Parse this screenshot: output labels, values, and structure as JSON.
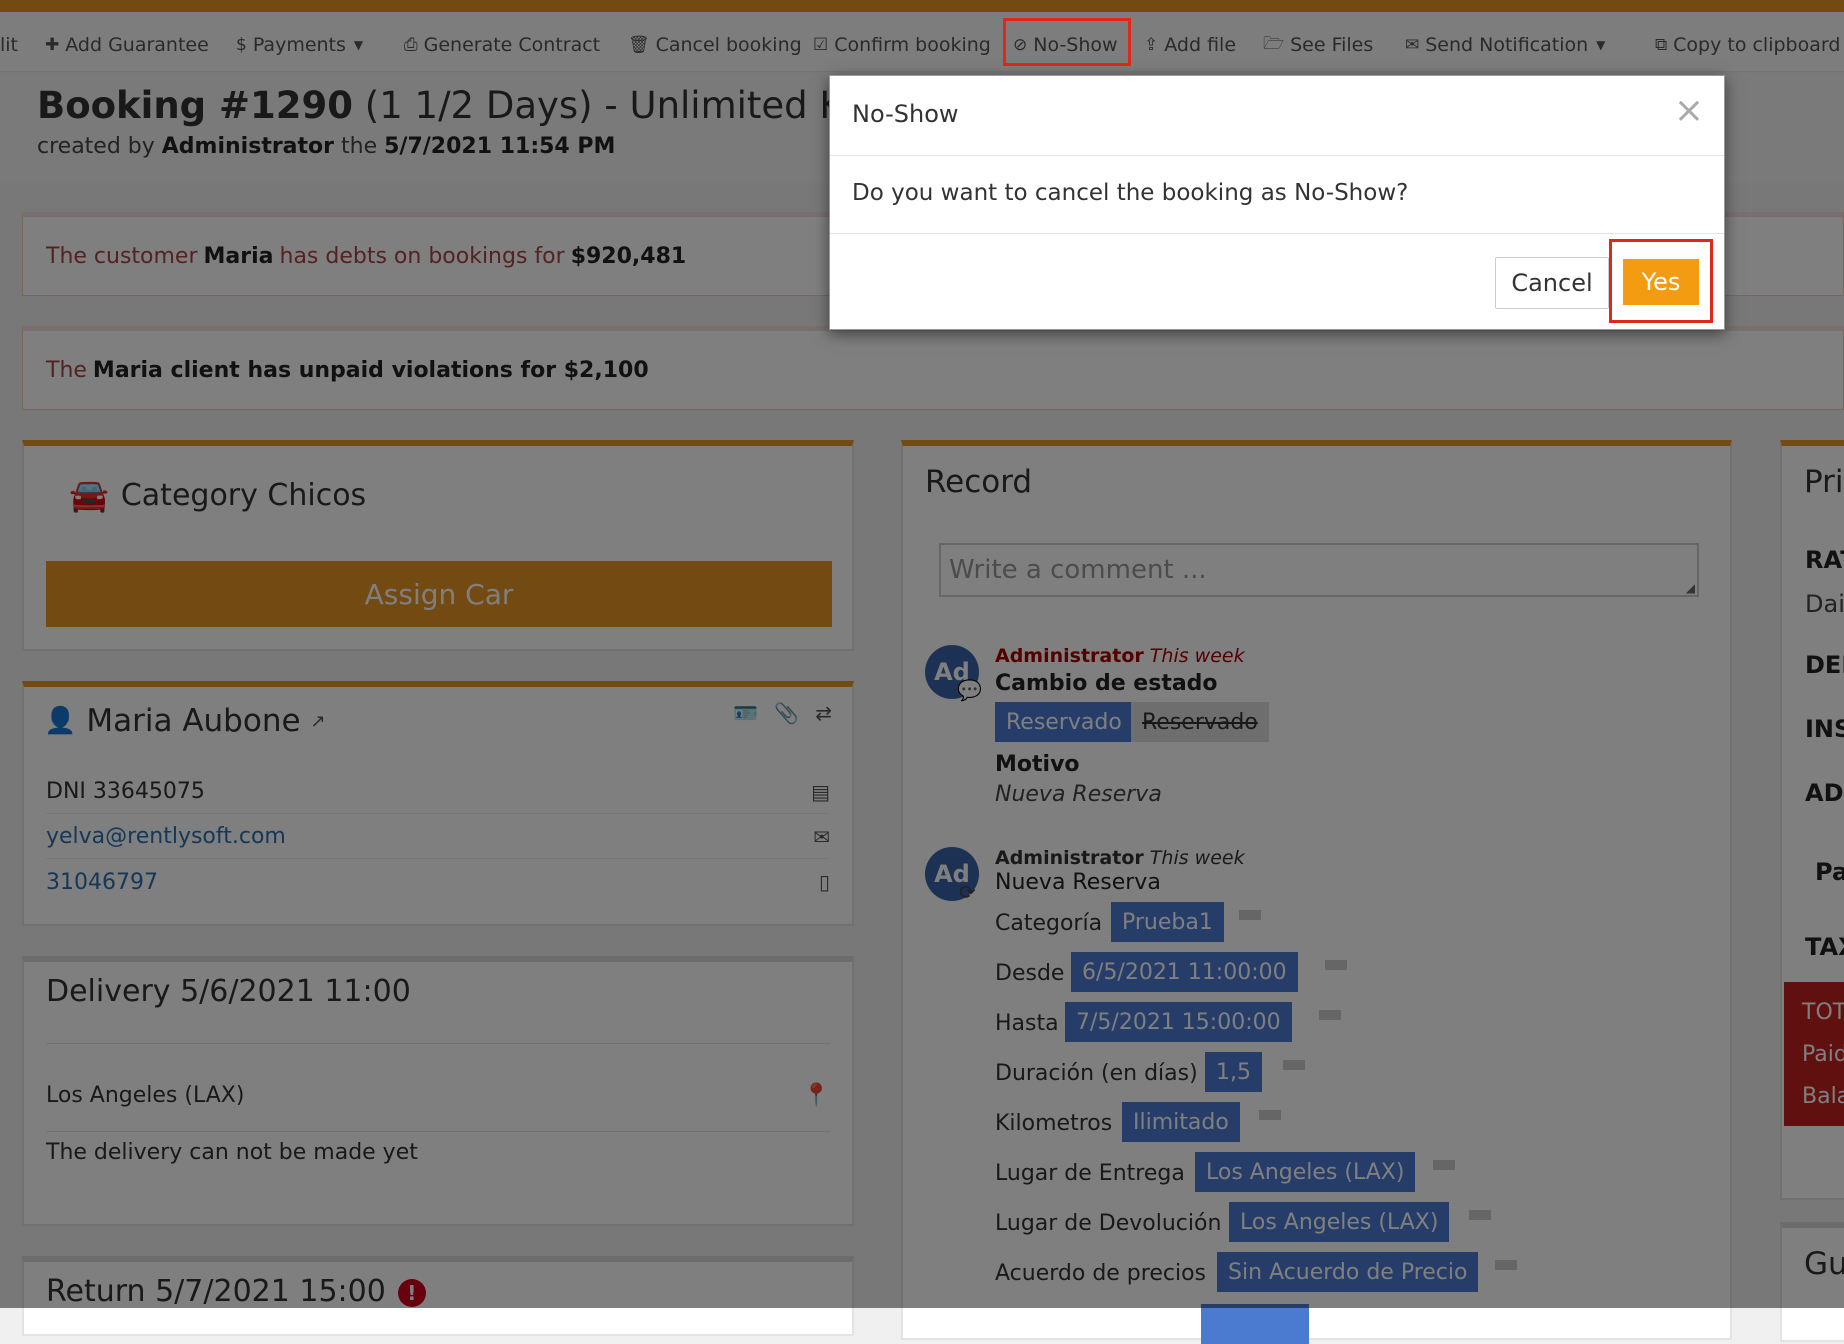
{
  "toolbar": {
    "items": [
      {
        "label": "lit"
      },
      {
        "label": "Add Guarantee",
        "icon": "plus-icon"
      },
      {
        "label": "Payments",
        "icon": "dollar-icon"
      },
      {
        "label": "Generate Contract",
        "icon": "print-icon"
      },
      {
        "label": "Cancel booking",
        "icon": "trash-icon"
      },
      {
        "label": "Confirm booking",
        "icon": "check-square-icon"
      },
      {
        "label": "No-Show",
        "icon": "ban-icon"
      },
      {
        "label": "Add file",
        "icon": "upload-icon"
      },
      {
        "label": "See Files",
        "icon": "folder-open-icon"
      },
      {
        "label": "Send Notification",
        "icon": "envelope-icon"
      },
      {
        "label": "Copy to clipboard",
        "icon": "copy-icon"
      }
    ],
    "accent_color": "#e59424"
  },
  "booking": {
    "number": "Booking #1290",
    "detail": "(1 1/2 Days) - Unlimited K",
    "created_prefix": "created by",
    "creator": "Administrator",
    "created_mid": "the",
    "created_at": "5/7/2021 11:54 PM"
  },
  "alerts": {
    "debt": {
      "pre": "The customer",
      "name": "Maria",
      "mid": "has debts on bookings for",
      "amount": "$920,481"
    },
    "violations": {
      "pre": "The",
      "bold": "Maria client has unpaid violations for $2,100"
    }
  },
  "category": {
    "title": "Category Chicos",
    "assign_label": "Assign Car"
  },
  "customer": {
    "name": "Maria Aubone",
    "dni": "DNI 33645075",
    "email": "yelva@rentlysoft.com",
    "phone": "31046797"
  },
  "delivery": {
    "title": "Delivery 5/6/2021 11:00",
    "location": "Los Angeles (LAX)",
    "note": "The delivery can not be made yet"
  },
  "return": {
    "title": "Return 5/7/2021 15:00"
  },
  "record": {
    "title": "Record",
    "comment_placeholder": "Write a comment ...",
    "event1": {
      "avatar": "Ad",
      "author": "Administrator",
      "when": "This week",
      "heading": "Cambio de estado",
      "status_new": "Reservado",
      "status_old": "Reservado",
      "reason_label": "Motivo",
      "reason": "Nueva Reserva"
    },
    "event2": {
      "avatar": "Ad",
      "author": "Administrator",
      "when": "This week",
      "heading": "Nueva Reserva",
      "fields": [
        {
          "label": "Categoría",
          "value": "Prueba1"
        },
        {
          "label": "Desde",
          "value": "6/5/2021 11:00:00"
        },
        {
          "label": "Hasta",
          "value": "7/5/2021 15:00:00"
        },
        {
          "label": "Duración (en días)",
          "value": "1,5"
        },
        {
          "label": "Kilometros",
          "value": "Ilimitado"
        },
        {
          "label": "Lugar de Entrega",
          "value": "Los Angeles (LAX)"
        },
        {
          "label": "Lugar de Devolución",
          "value": "Los Angeles (LAX)"
        },
        {
          "label": "Acuerdo de precios",
          "value": "Sin Acuerdo de Precio"
        }
      ]
    }
  },
  "price_panel": {
    "title": "Pri",
    "rows": [
      "RAT",
      "Dail",
      "DEP",
      "INS",
      "ADI",
      "Pa",
      "TAX"
    ],
    "totals": [
      "TOT",
      "Paid",
      "Bala"
    ],
    "guarantee_title": "Gu"
  },
  "modal": {
    "title": "No-Show",
    "close": "×",
    "message": "Do you want to cancel the booking as No-Show?",
    "cancel_label": "Cancel",
    "yes_label": "Yes"
  }
}
